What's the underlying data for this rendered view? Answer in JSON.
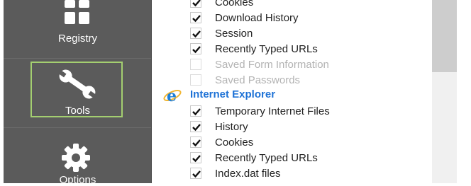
{
  "sidebar": {
    "items": [
      {
        "label": "Registry",
        "icon": "registry-tiles-icon"
      },
      {
        "label": "Tools",
        "icon": "wrench-icon",
        "selected": true
      },
      {
        "label": "Options",
        "icon": "gear-icon"
      }
    ],
    "selected_border_color": "#a4cf70"
  },
  "group_above": {
    "items": [
      {
        "label": "Cookies",
        "checked": true,
        "enabled": true
      },
      {
        "label": "Download History",
        "checked": true,
        "enabled": true
      },
      {
        "label": "Session",
        "checked": true,
        "enabled": true
      },
      {
        "label": "Recently Typed URLs",
        "checked": true,
        "enabled": true
      },
      {
        "label": "Saved Form Information",
        "checked": false,
        "enabled": false
      },
      {
        "label": "Saved Passwords",
        "checked": false,
        "enabled": false
      }
    ]
  },
  "internet_explorer": {
    "title": "Internet Explorer",
    "icon": "internet-explorer-icon",
    "title_color": "#1e72d6",
    "items": [
      {
        "label": "Temporary Internet Files",
        "checked": true,
        "enabled": true
      },
      {
        "label": "History",
        "checked": true,
        "enabled": true
      },
      {
        "label": "Cookies",
        "checked": true,
        "enabled": true
      },
      {
        "label": "Recently Typed URLs",
        "checked": true,
        "enabled": true
      },
      {
        "label": "Index.dat files",
        "checked": true,
        "enabled": true
      }
    ]
  }
}
